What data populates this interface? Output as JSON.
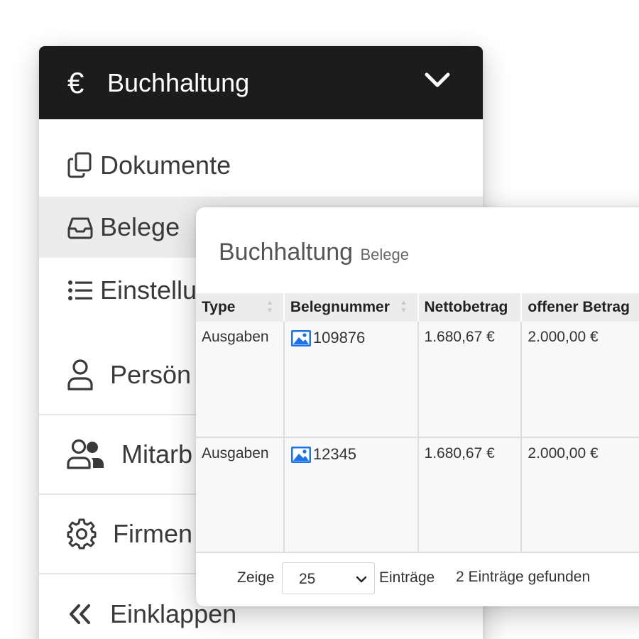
{
  "sidebar": {
    "header": {
      "title": "Buchhaltung",
      "icon": "euro-icon",
      "symbol": "€",
      "toggle_icon": "chevron-down-icon"
    },
    "items": [
      {
        "label": "Dokumente",
        "icon": "documents-icon"
      },
      {
        "label": "Belege",
        "icon": "inbox-icon",
        "active": true
      },
      {
        "label": "Einstellu",
        "icon": "list-icon"
      },
      {
        "label": "Persön",
        "icon": "person-icon"
      },
      {
        "label": "Mitarb",
        "icon": "users-icon"
      },
      {
        "label": "Firmen",
        "icon": "gear-icon"
      },
      {
        "label": "Einklappen",
        "icon": "chevrons-left-icon"
      }
    ]
  },
  "panel": {
    "title": "Buchhaltung",
    "subtitle": "Belege",
    "table": {
      "columns": [
        "Type",
        "Belegnummer",
        "Nettobetrag",
        "offener Betrag"
      ],
      "rows": [
        {
          "type": "Ausgaben",
          "belegnummer": "109876",
          "nettobetrag": "1.680,67 €",
          "offener_betrag": "2.000,00 €"
        },
        {
          "type": "Ausgaben",
          "belegnummer": "12345",
          "nettobetrag": "1.680,67 €",
          "offener_betrag": "2.000,00 €"
        }
      ]
    },
    "footer": {
      "show_label": "Zeige",
      "page_size": "25",
      "entries_label": "Einträge",
      "found_label": "2 Einträge gefunden"
    }
  },
  "colors": {
    "header_bg": "#1c1c1c",
    "active_item_bg": "#ececec",
    "image_icon": "#1a73e8"
  }
}
